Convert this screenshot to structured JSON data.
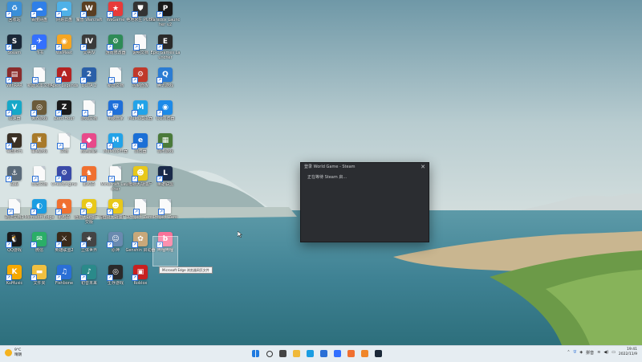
{
  "desktop_icons": [
    {
      "name": "recycle-bin-icon",
      "label": "回收站",
      "color": "#3b8fd8",
      "glyph": "♻"
    },
    {
      "name": "baidu-netdisk-icon",
      "label": "百度网盘",
      "color": "#2f7fe8",
      "glyph": "☁"
    },
    {
      "name": "cloud-icon",
      "label": "网易云盘",
      "color": "#4fb1e8",
      "glyph": "☁"
    },
    {
      "name": "warcraft-icon",
      "label": "魔兽 Warcraft",
      "color": "#5a3e21",
      "glyph": "W"
    },
    {
      "name": "game-store-icon",
      "label": "WeGame",
      "color": "#e83a3a",
      "glyph": "★"
    },
    {
      "name": "shield-game-icon",
      "label": "绝地求生 PUBG",
      "color": "#333",
      "glyph": "⛊"
    },
    {
      "name": "paradox-launcher-icon",
      "label": "Paradox Launcher v2",
      "color": "#1a1a1a",
      "glyph": "P"
    },
    {
      "name": "steam-icon",
      "label": "Steam",
      "color": "#1b2838",
      "glyph": "S"
    },
    {
      "name": "feishu-icon",
      "label": "飞书",
      "color": "#3370ff",
      "glyph": "✈"
    },
    {
      "name": "wemeet-icon",
      "label": "WeMeet",
      "color": "#f5a623",
      "glyph": "◉"
    },
    {
      "name": "civ4-icon",
      "label": "文明IV",
      "color": "#3a3a3a",
      "glyph": "IV"
    },
    {
      "name": "mod-tool-icon",
      "label": "游戏修改器",
      "color": "#2e8b57",
      "glyph": "⚙"
    },
    {
      "name": "file-icon",
      "label": "说明文档",
      "color": "file",
      "glyph": ""
    },
    {
      "name": "epic-games-icon",
      "label": "Epic Games Launcher",
      "color": "#2a2a2a",
      "glyph": "E"
    },
    {
      "name": "winrar-icon",
      "label": "WinRAR",
      "color": "#8b2c2c",
      "glyph": "▤"
    },
    {
      "name": "file-icon",
      "label": "新建文本文档",
      "color": "file",
      "glyph": ""
    },
    {
      "name": "apex-legends-icon",
      "label": "Apex Legends",
      "color": "#b52222",
      "glyph": "A"
    },
    {
      "name": "dota2-icon",
      "label": "DOTA 2",
      "color": "#2a5fa8",
      "glyph": "2"
    },
    {
      "name": "file-icon",
      "label": "新建文档",
      "color": "file",
      "glyph": ""
    },
    {
      "name": "control-panel-icon",
      "label": "控制面板",
      "color": "#c0392b",
      "glyph": "⚙"
    },
    {
      "name": "tencent-game-icon",
      "label": "腾讯游戏",
      "color": "#2b7cd3",
      "glyph": "Q"
    },
    {
      "name": "vpn-icon",
      "label": "加速器",
      "color": "#16a8c8",
      "glyph": "V"
    },
    {
      "name": "globe-game-icon",
      "label": "世界游戏",
      "color": "#6b5b3a",
      "glyph": "◎"
    },
    {
      "name": "zero-hour-icon",
      "label": "Zero Hour",
      "color": "#1a1a1a",
      "glyph": "Z"
    },
    {
      "name": "file-icon",
      "label": "游戏文档",
      "color": "file",
      "glyph": ""
    },
    {
      "name": "security-icon",
      "label": "电脑管家",
      "color": "#1e6fd9",
      "glyph": "⛨"
    },
    {
      "name": "mumu-icon",
      "label": "MuMu模拟器",
      "color": "#22a3e8",
      "glyph": "M"
    },
    {
      "name": "qq-browser-icon",
      "label": "QQ浏览器",
      "color": "#1c8ae8",
      "glyph": "◉"
    },
    {
      "name": "age-game-icon",
      "label": "帝国时代",
      "color": "#3a3025",
      "glyph": "▼"
    },
    {
      "name": "strategy-game-icon",
      "label": "策略游戏",
      "color": "#a87a2a",
      "glyph": "♜"
    },
    {
      "name": "file-icon",
      "label": "文档",
      "color": "file",
      "glyph": ""
    },
    {
      "name": "app-store-icon",
      "label": "应用商店",
      "color": "#e84a8a",
      "glyph": "◆"
    },
    {
      "name": "mumu-multi-icon",
      "label": "MuMu多开器",
      "color": "#22a3e8",
      "glyph": "M"
    },
    {
      "name": "ie-icon",
      "label": "浏览器",
      "color": "#1a6fd6",
      "glyph": "e"
    },
    {
      "name": "city-game-icon",
      "label": "城市游戏",
      "color": "#4a7a3a",
      "glyph": "▦"
    },
    {
      "name": "warship-icon",
      "label": "战舰",
      "color": "#5a6a7a",
      "glyph": "⚓"
    },
    {
      "name": "file-icon",
      "label": "日志文档",
      "color": "file",
      "glyph": ""
    },
    {
      "name": "cheat-engine-icon",
      "label": "CheatEngine",
      "color": "#3a4aa8",
      "glyph": "⚙"
    },
    {
      "name": "goose-game-icon",
      "label": "鹅鸭杀",
      "color": "#f07030",
      "glyph": "♞"
    },
    {
      "name": "file-icon",
      "label": "Minecraft Launcher",
      "color": "file",
      "glyph": ""
    },
    {
      "name": "pvz-icon",
      "label": "植物大战僵尸",
      "color": "#e8c81a",
      "glyph": "☻"
    },
    {
      "name": "lol-icon",
      "label": "英雄联盟",
      "color": "#1a2a4a",
      "glyph": "L"
    },
    {
      "name": "file-icon",
      "label": "新建文档2",
      "color": "file",
      "glyph": ""
    },
    {
      "name": "edge-icon",
      "label": "Microsoft Edge",
      "color": "#1b9de2",
      "glyph": "◐"
    },
    {
      "name": "goose-icon",
      "label": "鹅鸭杀",
      "color": "#f07030",
      "glyph": "♞"
    },
    {
      "name": "pvz2-icon",
      "label": "植物大战僵尸 杂交版",
      "color": "#e8c81a",
      "glyph": "☻"
    },
    {
      "name": "pvz3-icon",
      "label": "植物大战僵尸2",
      "color": "#e8c81a",
      "glyph": "☻"
    },
    {
      "name": "file-icon",
      "label": "Project Zero",
      "color": "file",
      "glyph": ""
    },
    {
      "name": "file-icon",
      "label": "Project Zero",
      "color": "file",
      "glyph": ""
    },
    {
      "name": "qq-icon",
      "label": "QQ游戏",
      "color": "#1a1a1a",
      "glyph": "🐧"
    },
    {
      "name": "wechat-icon",
      "label": "微信",
      "color": "#2aae67",
      "glyph": "✉"
    },
    {
      "name": "hero-game-icon",
      "label": "英雄联盟2",
      "color": "#3a2a1a",
      "glyph": "⚔"
    },
    {
      "name": "star-game-icon",
      "label": "立体世界",
      "color": "#444",
      "glyph": "★"
    },
    {
      "name": "anime-game-icon",
      "label": "原神",
      "color": "#6a8ab0",
      "glyph": "☺"
    },
    {
      "name": "genshin-icon",
      "label": "Genshin 启动器",
      "color": "#c8a87a",
      "glyph": "✿"
    },
    {
      "name": "bilibili-icon",
      "label": "哔哩哔哩",
      "color": "#fb7299",
      "glyph": "b"
    },
    {
      "name": "kumusic-icon",
      "label": "KuMusic",
      "color": "#f5a800",
      "glyph": "K"
    },
    {
      "name": "folder-icon",
      "label": "文件夹",
      "color": "#f0c040",
      "glyph": "▬"
    },
    {
      "name": "fishing-game-icon",
      "label": "Fishbone",
      "color": "#2a6fd6",
      "glyph": "♫"
    },
    {
      "name": "hatsune-icon",
      "label": "初音未来",
      "color": "#2a8a8a",
      "glyph": "♪"
    },
    {
      "name": "gear-game-icon",
      "label": "生存游戏",
      "color": "#2a2a2a",
      "glyph": "◎"
    },
    {
      "name": "roblox-icon",
      "label": "Roblox",
      "color": "#c82020",
      "glyph": "▣"
    }
  ],
  "steam_dialog": {
    "title": "登录 World Game - Steam",
    "message": "正在等待 Steam 启…",
    "close_glyph": "✕"
  },
  "tooltip": {
    "text": "Microsoft Edge 浏览器网页文件"
  },
  "taskbar": {
    "weather_temp": "9°C",
    "weather_desc": "晴朗",
    "apps": [
      {
        "name": "windows-start-icon",
        "color": "#1f7ae0"
      },
      {
        "name": "search-icon",
        "color": "#333"
      },
      {
        "name": "task-view-icon",
        "color": "#444"
      },
      {
        "name": "file-explorer-icon",
        "color": "#f0b93a"
      },
      {
        "name": "edge-icon",
        "color": "#1b9de2"
      },
      {
        "name": "browser-icon",
        "color": "#2a6fd6"
      },
      {
        "name": "feishu-icon",
        "color": "#3370ff"
      },
      {
        "name": "goose-game-icon",
        "color": "#f07030"
      },
      {
        "name": "goose-icon",
        "color": "#f0862a"
      },
      {
        "name": "steam-icon",
        "color": "#1b2838"
      }
    ],
    "tray_ime": "拼音",
    "clock_time": "19:41",
    "clock_date": "2022/11/9"
  }
}
